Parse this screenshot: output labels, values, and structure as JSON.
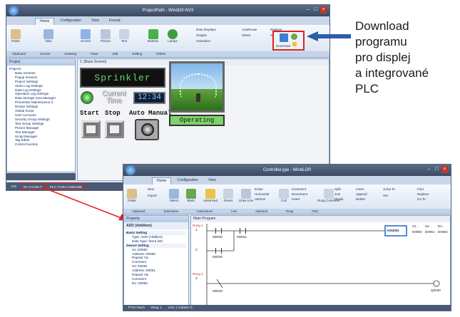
{
  "window1": {
    "title": "ProjectPath - WindO/I-NV3",
    "tabs": [
      "Home",
      "Configuration",
      "View",
      "Format"
    ],
    "ribbon": [
      "Paste",
      "New",
      "Screen",
      "Picture",
      "Text",
      "Buttons",
      "Lamps",
      "Data Displays",
      "Graphs",
      "Animation",
      "AutoRoute",
      "Select",
      "Replace",
      "Select"
    ],
    "download_label": "Download",
    "groups": [
      "Clipboard",
      "Screen",
      "Drawing",
      "Parts",
      "Edit",
      "Editing",
      "Online"
    ],
    "project_title": "Project",
    "project_tree": [
      "Project1",
      "Base Screens",
      "Popup Screens",
      "Project Settings",
      "Alarm Log Settings",
      "Data Log Settings",
      "Operation Log Settings",
      "Data Storage Area Manager",
      "Preventive Maintenance S",
      "Recipe Settings",
      "Global Script",
      "User Accounts",
      "Security Group Settings",
      "Text Group Settings",
      "Picture Manager",
      "Text Manager",
      "Script Manager",
      "Tag Editor",
      "Control function"
    ],
    "screen_tab": "1: [Base Screen]",
    "status": [
      "HG",
      "OI: H-G1N-T",
      "PLC: FC6A-C40K1DE"
    ]
  },
  "hmi": {
    "title": "Sprinkler",
    "current": "Current",
    "time": "Time",
    "clock": "12:34",
    "start": "Start",
    "stop": "Stop",
    "auto_manual": "Auto Manual",
    "operating": "Operating"
  },
  "caption": [
    "Download",
    "programu",
    "pro displej",
    "a integrované",
    "PLC"
  ],
  "window2": {
    "title": "Controller.pjw - WindLDR",
    "tabs": [
      "Home",
      "Configuration",
      "View"
    ],
    "ribbon": [
      "Paste",
      "New",
      "Import",
      "Select",
      "Basic",
      "Advanced",
      "Reset",
      "Draw Line",
      "Erase",
      "Horizontal",
      "Vertical",
      "Coil",
      "Increment",
      "Decrement",
      "Invert",
      "Rung Comment",
      "Split",
      "Join",
      "Divide",
      "Insert",
      "Append",
      "Delete",
      "Jump To",
      "Set",
      "Find",
      "Replace",
      "Go To"
    ],
    "groups": [
      "Clipboard",
      "Subroutine",
      "Instructions",
      "Line",
      "Operand",
      "Rung",
      "Find"
    ],
    "property_title": "Property",
    "property_header": "ADD (Addition)",
    "properties": [
      "Basic Setting",
      "Type: ADD (Addition)",
      "Data Type: Word (W)",
      "Device Setting",
      "S1: D0050",
      "Address: D0050",
      "Repeat: No",
      "Comment",
      "S2: D0051",
      "Address: D0051",
      "Repeat: No",
      "Comment",
      "D1: D0050"
    ],
    "program_tab": "Main Program",
    "status": [
      "FT1A Touch",
      "Rung: 1",
      "Line: 1  Column: 6"
    ]
  },
  "ladder": {
    "rung1": "Rung 1",
    "rung2": "Rung 2",
    "line1": "1",
    "line2": "2",
    "line3": "3",
    "c1": "M0030",
    "c2": "M0031",
    "c3": "M0030",
    "c4": "M0030",
    "instr": "ADD(W)",
    "s1": "S1 -",
    "s2": "S2 -",
    "d1": "D1 -",
    "v1": "D0050",
    "v2": "D0051",
    "v3": "D0050",
    "coil": "Q0030"
  }
}
